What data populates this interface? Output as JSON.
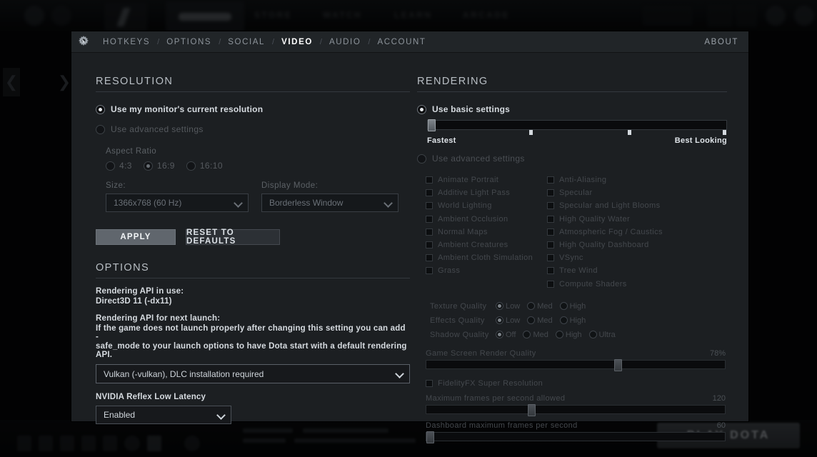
{
  "background": {
    "top_nav": [
      "HEROES",
      "STORE",
      "WATCH",
      "LEARN",
      "ARCADE"
    ],
    "play_button_label": "PLAY DOTA"
  },
  "panel": {
    "gear_icon": "gear-icon",
    "nav": {
      "separator": "/",
      "tabs": [
        {
          "label": "HOTKEYS",
          "active": false
        },
        {
          "label": "OPTIONS",
          "active": false
        },
        {
          "label": "SOCIAL",
          "active": false
        },
        {
          "label": "VIDEO",
          "active": true
        },
        {
          "label": "AUDIO",
          "active": false
        },
        {
          "label": "ACCOUNT",
          "active": false
        }
      ],
      "about_label": "ABOUT"
    }
  },
  "resolution": {
    "title": "RESOLUTION",
    "mode_current_label": "Use my monitor's current resolution",
    "mode_advanced_label": "Use advanced settings",
    "aspect_ratio_label": "Aspect Ratio",
    "aspect_options": [
      {
        "label": "4:3",
        "selected": false
      },
      {
        "label": "16:9",
        "selected": true
      },
      {
        "label": "16:10",
        "selected": false
      }
    ],
    "size_label": "Size:",
    "size_value": "1366x768 (60 Hz)",
    "display_mode_label": "Display Mode:",
    "display_mode_value": "Borderless Window",
    "apply_label": "APPLY",
    "reset_label": "RESET TO DEFAULTS"
  },
  "options": {
    "title": "OPTIONS",
    "api_in_use_label": "Rendering API in use:",
    "api_in_use_value": "Direct3D 11 (-dx11)",
    "api_next_label": "Rendering API for next launch:",
    "api_next_help_line1": "If the game does not launch properly after changing this setting you can add -",
    "api_next_help_line2": "safe_mode to your launch options to have Dota start with a default rendering API.",
    "api_next_value": "Vulkan (-vulkan), DLC installation required",
    "reflex_label": "NVIDIA Reflex Low Latency",
    "reflex_value": "Enabled"
  },
  "rendering": {
    "title": "RENDERING",
    "basic_label": "Use basic settings",
    "advanced_label": "Use advanced settings",
    "quality_slider": {
      "left_label": "Fastest",
      "right_label": "Best Looking",
      "handle_percent": 0,
      "ticks_percent": [
        34,
        67,
        100
      ]
    },
    "checkboxes_left": [
      {
        "label": "Animate Portrait",
        "checked": false
      },
      {
        "label": "Additive Light Pass",
        "checked": false
      },
      {
        "label": "World Lighting",
        "checked": false
      },
      {
        "label": "Ambient Occlusion",
        "checked": false
      },
      {
        "label": "Normal Maps",
        "checked": false
      },
      {
        "label": "Ambient Creatures",
        "checked": false
      },
      {
        "label": "Ambient Cloth Simulation",
        "checked": false
      },
      {
        "label": "Grass",
        "checked": false
      }
    ],
    "checkboxes_right": [
      {
        "label": "Anti-Aliasing",
        "checked": false
      },
      {
        "label": "Specular",
        "checked": false
      },
      {
        "label": "Specular and Light Blooms",
        "checked": false
      },
      {
        "label": "High Quality Water",
        "checked": false
      },
      {
        "label": "Atmospheric Fog / Caustics",
        "checked": false
      },
      {
        "label": "High Quality Dashboard",
        "checked": false
      },
      {
        "label": "VSync",
        "checked": false
      },
      {
        "label": "Tree Wind",
        "checked": false
      },
      {
        "label": "Compute Shaders",
        "checked": false
      }
    ],
    "quality_rows": [
      {
        "name": "Texture Quality",
        "options": [
          {
            "label": "Low",
            "selected": true
          },
          {
            "label": "Med",
            "selected": false
          },
          {
            "label": "High",
            "selected": false
          }
        ]
      },
      {
        "name": "Effects Quality",
        "options": [
          {
            "label": "Low",
            "selected": true
          },
          {
            "label": "Med",
            "selected": false
          },
          {
            "label": "High",
            "selected": false
          }
        ]
      },
      {
        "name": "Shadow Quality",
        "options": [
          {
            "label": "Off",
            "selected": true
          },
          {
            "label": "Med",
            "selected": false
          },
          {
            "label": "High",
            "selected": false
          },
          {
            "label": "Ultra",
            "selected": false
          }
        ]
      }
    ],
    "render_quality": {
      "label": "Game Screen Render Quality",
      "value": "78%",
      "handle_percent": 63
    },
    "fsr_label": "FidelityFX Super Resolution",
    "max_fps": {
      "label": "Maximum frames per second allowed",
      "value": "120",
      "handle_percent": 34
    },
    "dashboard_fps": {
      "label": "Dashboard maximum frames per second",
      "value": "60",
      "handle_percent": 0
    }
  }
}
